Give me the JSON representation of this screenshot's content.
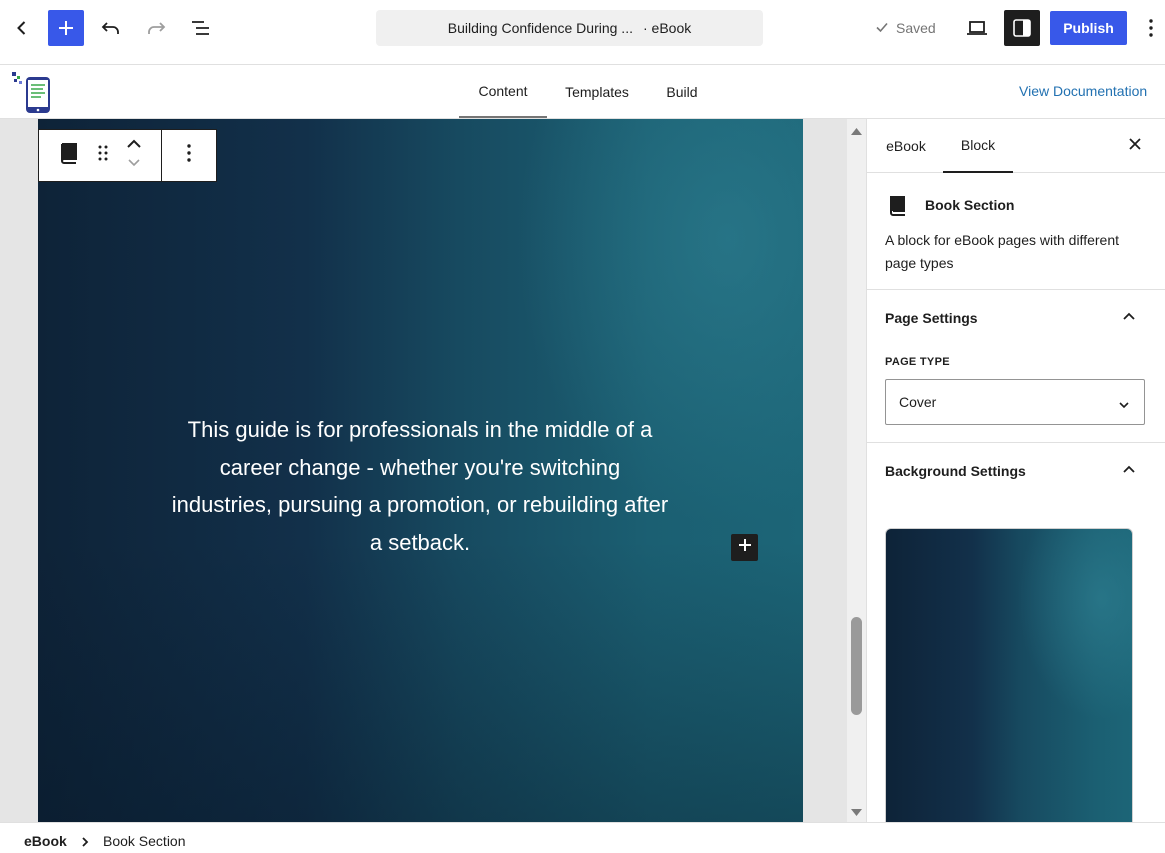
{
  "header": {
    "document_title": "Building Confidence During ...",
    "document_type": "· eBook",
    "saved_label": "Saved",
    "publish_label": "Publish",
    "colors": {
      "accent": "#3858e9",
      "dark": "#1e1e1e"
    },
    "icons": [
      "back-chevron-icon",
      "plus-icon",
      "undo-icon",
      "redo-icon",
      "list-view-icon",
      "check-icon",
      "laptop-icon",
      "sidebar-toggle-icon",
      "vertical-ellipsis-icon"
    ]
  },
  "subnav": {
    "tabs": [
      {
        "label": "Content",
        "active": true
      },
      {
        "label": "Templates",
        "active": false
      },
      {
        "label": "Build",
        "active": false
      }
    ],
    "view_documentation_label": "View Documentation"
  },
  "canvas": {
    "cover_text": "This guide is for professionals in the middle of a career change - whether you're switching industries, pursuing a promotion, or rebuilding after a setback.",
    "block_toolbar_icons": [
      "book-icon",
      "drag-handle-icon",
      "move-up-icon",
      "move-down-icon",
      "options-icon"
    ],
    "colors": {
      "cover_dark": "#0e2338",
      "cover_teal": "#1c6577"
    }
  },
  "sidebar": {
    "tabs": [
      {
        "label": "eBook",
        "active": false
      },
      {
        "label": "Block",
        "active": true
      }
    ],
    "block": {
      "title": "Book Section",
      "description": "A block for eBook pages with different page types"
    },
    "page_settings": {
      "title": "Page Settings",
      "page_type_label": "PAGE TYPE",
      "page_type_value": "Cover"
    },
    "background_settings": {
      "title": "Background Settings"
    }
  },
  "breadcrumb": {
    "root": "eBook",
    "leaf": "Book Section"
  }
}
